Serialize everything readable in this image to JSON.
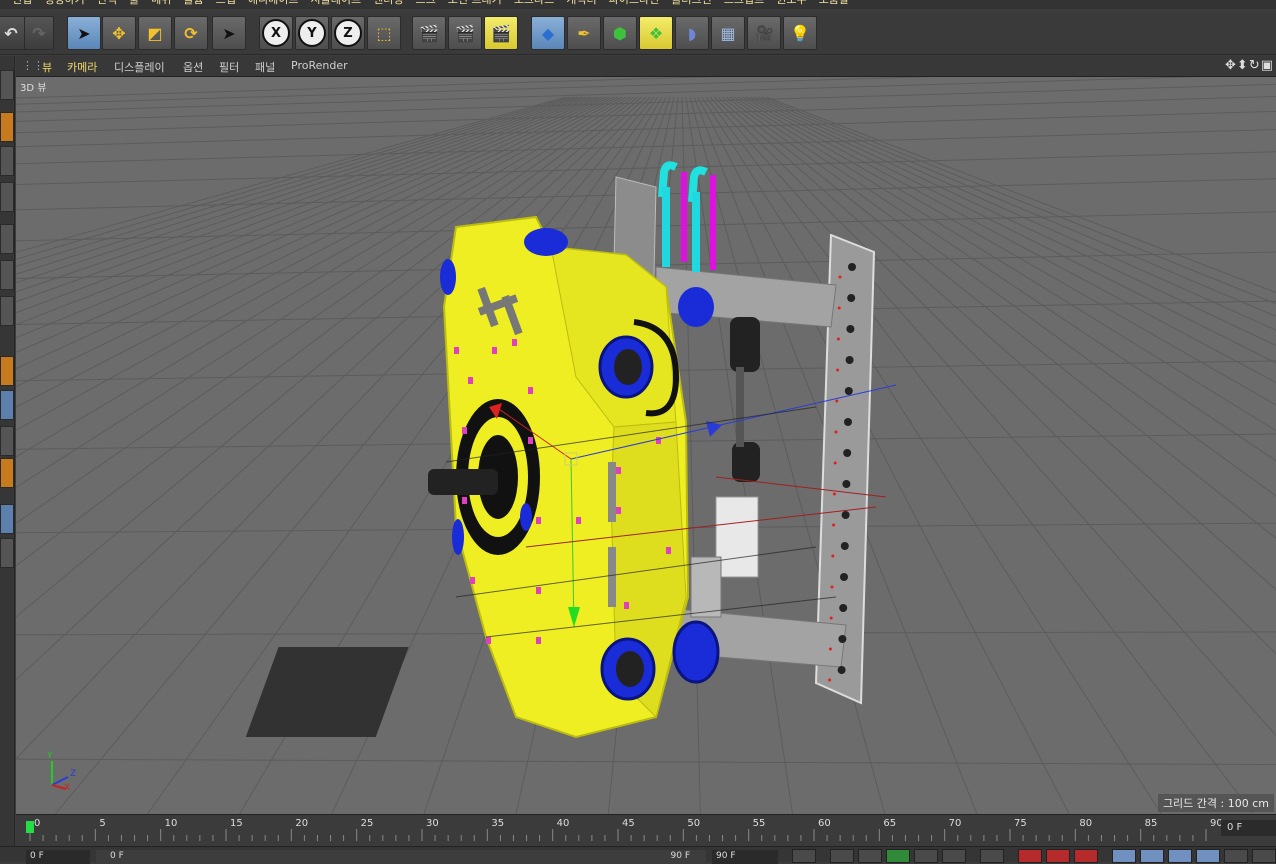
{
  "menubar": {
    "items": [
      "편집",
      "생성하기",
      "선택",
      "툴",
      "메쉬",
      "볼륨",
      "스냅",
      "애니메이트",
      "시뮬레이트",
      "렌더링",
      "스크",
      "모션 트래커",
      "모그라프",
      "캐릭터",
      "파이프라인",
      "플러그인",
      "스크립트",
      "윈도우",
      "도움말"
    ]
  },
  "viewmenu": {
    "items": [
      "뷰",
      "카메라",
      "디스플레이",
      "옵션",
      "필터",
      "패널",
      "ProRender"
    ],
    "nav_icons": "✥⬍↻▣"
  },
  "viewport": {
    "label": "3D 뷰",
    "grid_label": "그리드 간격 : 100 cm",
    "axis_labels": {
      "y": "Y",
      "z": "Z",
      "x": "X"
    }
  },
  "toolbar": {
    "axis_x": "X",
    "axis_y": "Y",
    "axis_z": "Z"
  },
  "timeline": {
    "ticks": [
      "0",
      "5",
      "10",
      "15",
      "20",
      "25",
      "30",
      "35",
      "40",
      "45",
      "50",
      "55",
      "60",
      "65",
      "70",
      "75",
      "80",
      "85",
      "90"
    ],
    "current_frame": "0 F"
  },
  "transport": {
    "start_field": "0 F",
    "range_start": "0 F",
    "range_end": "90 F",
    "end_field": "90 F"
  },
  "colors": {
    "accent_yellow": "#f3d96b",
    "model_yellow": "#f0f01a",
    "thruster_blue": "#1a2bd8"
  }
}
